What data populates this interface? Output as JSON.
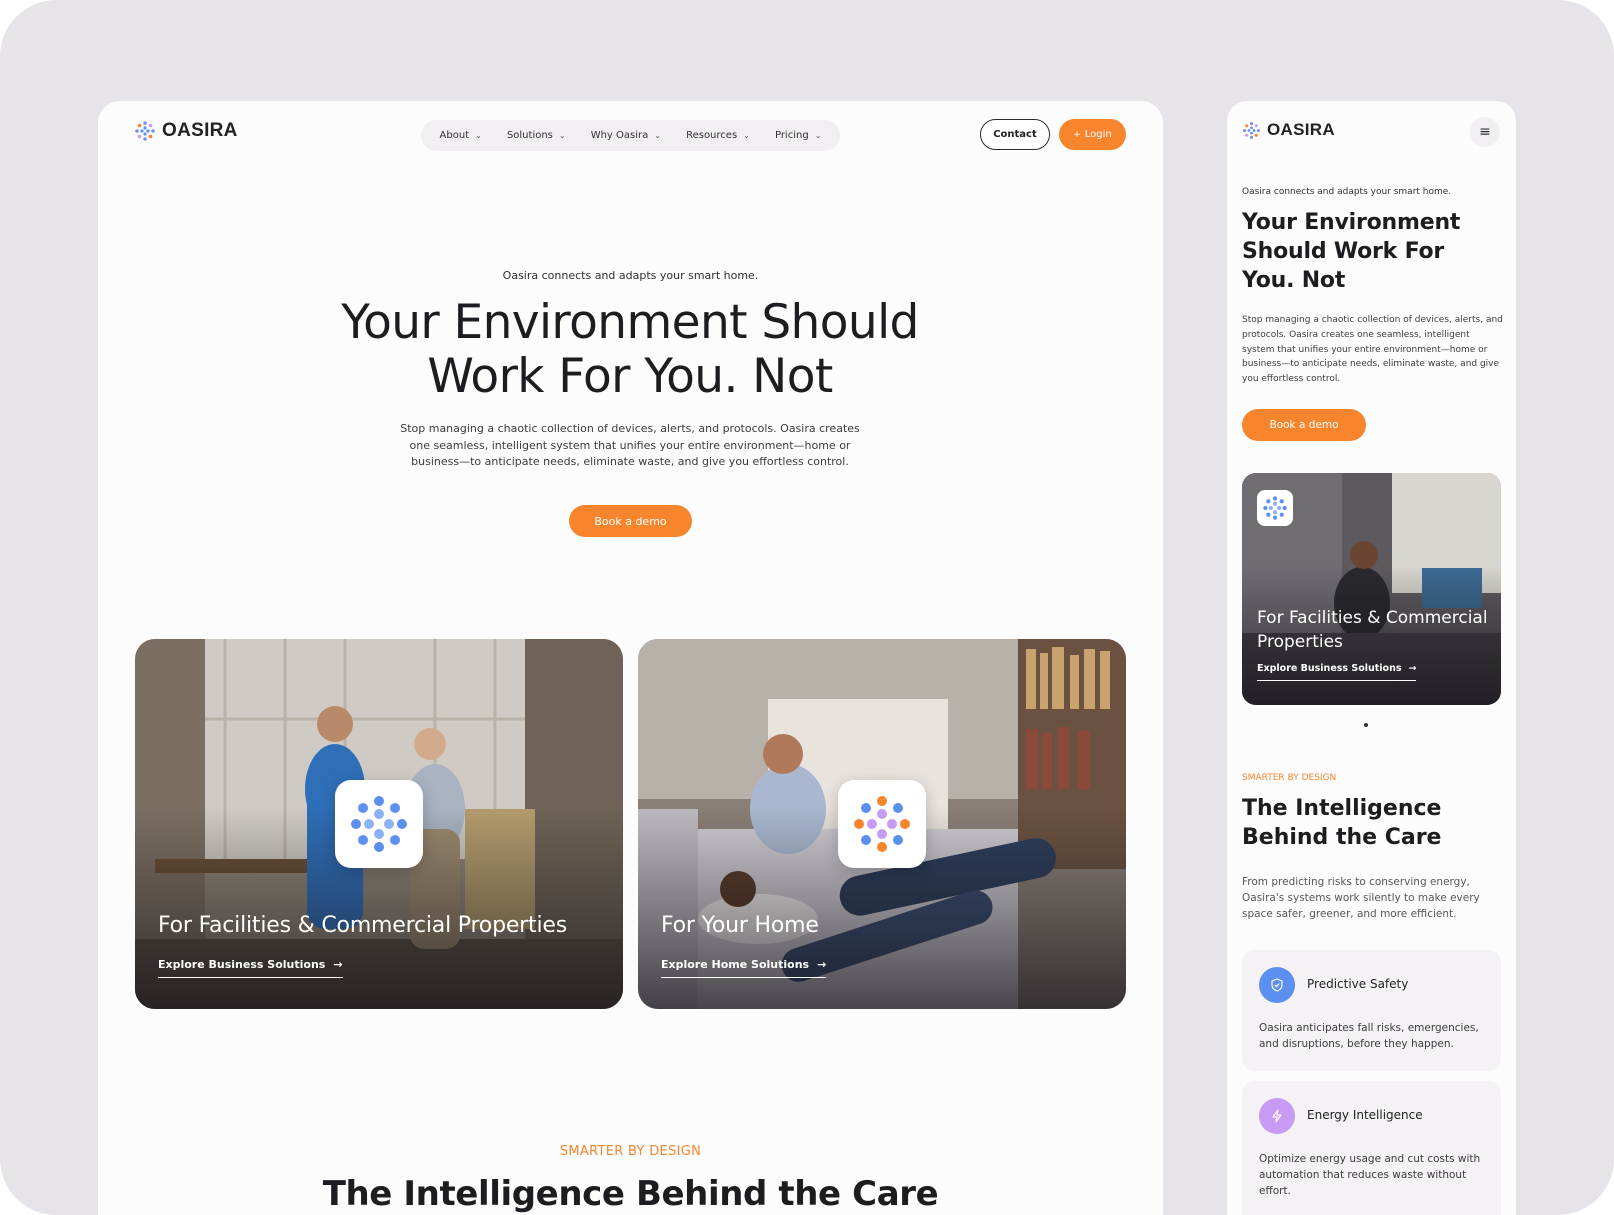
{
  "brand": {
    "name": "OASIRA",
    "accent": "#f7852e"
  },
  "nav": {
    "items": [
      {
        "label": "About"
      },
      {
        "label": "Solutions"
      },
      {
        "label": "Why Oasira"
      },
      {
        "label": "Resources"
      },
      {
        "label": "Pricing"
      }
    ],
    "contact_label": "Contact",
    "login_label": "Login"
  },
  "hero": {
    "eyebrow": "Oasira connects and adapts your smart home.",
    "title": "Your Environment Should Work For You. Not",
    "description": "Stop managing a chaotic collection of devices, alerts, and protocols. Oasira creates one seamless, intelligent system that unifies your entire environment—home or business—to anticipate needs, eliminate waste, and give you effortless control.",
    "cta_label": "Book a demo"
  },
  "cards": [
    {
      "title": "For Facilities & Commercial Properties",
      "link": "Explore Business Solutions"
    },
    {
      "title": "For Your Home",
      "link": "Explore Home Solutions"
    }
  ],
  "section": {
    "eyebrow": "SMARTER BY DESIGN",
    "title": "The Intelligence Behind the Care",
    "description": "From predicting risks to conserving energy, Oasira's systems work silently to make every space safer, greener, and more efficient."
  },
  "mobile": {
    "eyebrow": "SMARTER BY DESIGN",
    "features": [
      {
        "name": "Predictive Safety",
        "text": "Oasira anticipates fall risks, emergencies, and disruptions, before they happen.",
        "icon": "shield-icon",
        "color": "#5b8ff0"
      },
      {
        "name": "Energy Intelligence",
        "text": "Optimize energy usage and cut costs with automation that reduces waste without effort.",
        "icon": "bolt-icon",
        "color": "#c79af3"
      }
    ]
  }
}
